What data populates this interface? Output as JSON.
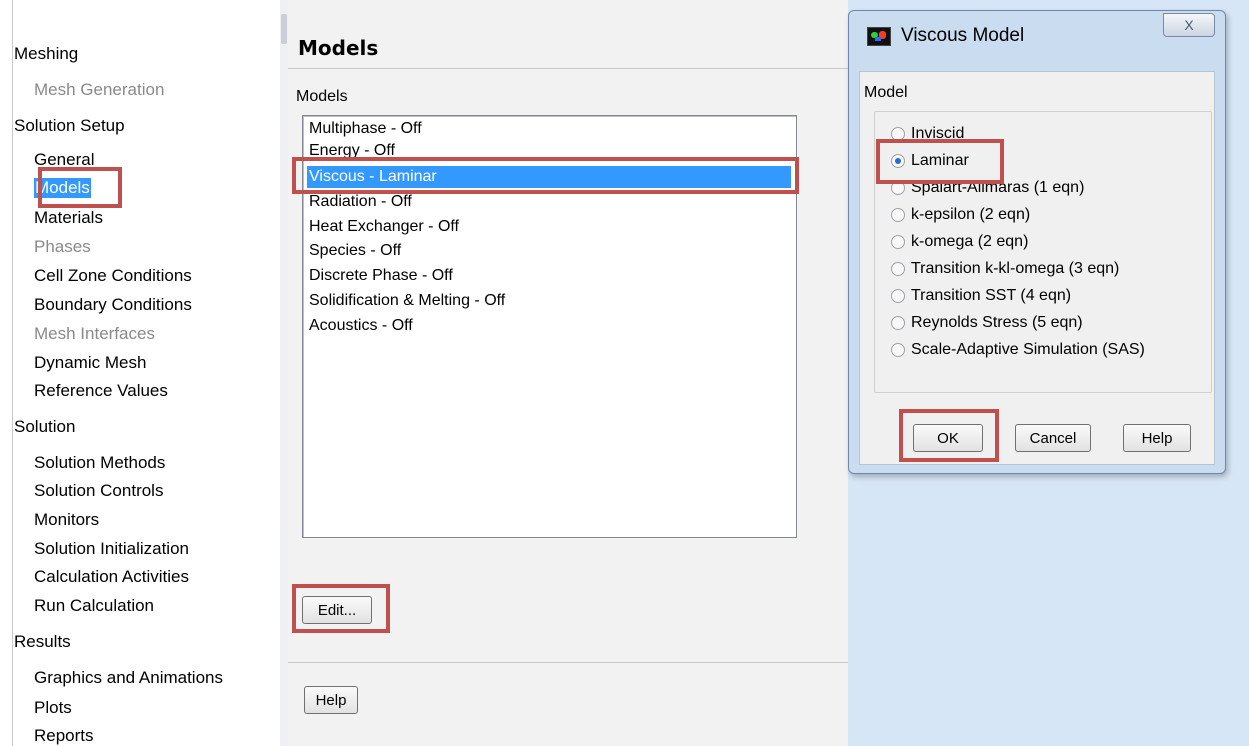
{
  "nav": {
    "items": [
      {
        "label": "Meshing",
        "level": 0,
        "enabled": true
      },
      {
        "label": "Mesh Generation",
        "level": 1,
        "enabled": false
      },
      {
        "label": "Solution Setup",
        "level": 0,
        "enabled": true
      },
      {
        "label": "General",
        "level": 1,
        "enabled": true
      },
      {
        "label": "Models",
        "level": 1,
        "enabled": true,
        "selected": true
      },
      {
        "label": "Materials",
        "level": 1,
        "enabled": true
      },
      {
        "label": "Phases",
        "level": 1,
        "enabled": false
      },
      {
        "label": "Cell Zone Conditions",
        "level": 1,
        "enabled": true
      },
      {
        "label": "Boundary Conditions",
        "level": 1,
        "enabled": true
      },
      {
        "label": "Mesh Interfaces",
        "level": 1,
        "enabled": false
      },
      {
        "label": "Dynamic Mesh",
        "level": 1,
        "enabled": true
      },
      {
        "label": "Reference Values",
        "level": 1,
        "enabled": true
      },
      {
        "label": "Solution",
        "level": 0,
        "enabled": true
      },
      {
        "label": "Solution Methods",
        "level": 1,
        "enabled": true
      },
      {
        "label": "Solution Controls",
        "level": 1,
        "enabled": true
      },
      {
        "label": "Monitors",
        "level": 1,
        "enabled": true
      },
      {
        "label": "Solution Initialization",
        "level": 1,
        "enabled": true
      },
      {
        "label": "Calculation Activities",
        "level": 1,
        "enabled": true
      },
      {
        "label": "Run Calculation",
        "level": 1,
        "enabled": true
      },
      {
        "label": "Results",
        "level": 0,
        "enabled": true
      },
      {
        "label": "Graphics and Animations",
        "level": 1,
        "enabled": true
      },
      {
        "label": "Plots",
        "level": 1,
        "enabled": true
      },
      {
        "label": "Reports",
        "level": 1,
        "enabled": true
      }
    ]
  },
  "task": {
    "title": "Models",
    "list_label": "Models",
    "models": [
      "Multiphase - Off",
      "Energy - Off",
      "Viscous - Laminar",
      "Radiation - Off",
      "Heat Exchanger - Off",
      "Species - Off",
      "Discrete Phase - Off",
      "Solidification & Melting - Off",
      "Acoustics - Off"
    ],
    "selected_model": "Viscous - Laminar",
    "edit_label": "Edit...",
    "help_label": "Help"
  },
  "dialog": {
    "title": "Viscous Model",
    "close_label": "X",
    "group_label": "Model",
    "options": [
      "Inviscid",
      "Laminar",
      "Spalart-Allmaras (1 eqn)",
      "k-epsilon (2 eqn)",
      "k-omega (2 eqn)",
      "Transition k-kl-omega (3 eqn)",
      "Transition SST (4 eqn)",
      "Reynolds Stress (5 eqn)",
      "Scale-Adaptive Simulation (SAS)"
    ],
    "selected_option": "Laminar",
    "ok_label": "OK",
    "cancel_label": "Cancel",
    "help_label": "Help"
  },
  "colors": {
    "highlight": "#c0504d",
    "selection": "#3399ff",
    "dialog_frame": "#c9dcf0"
  }
}
